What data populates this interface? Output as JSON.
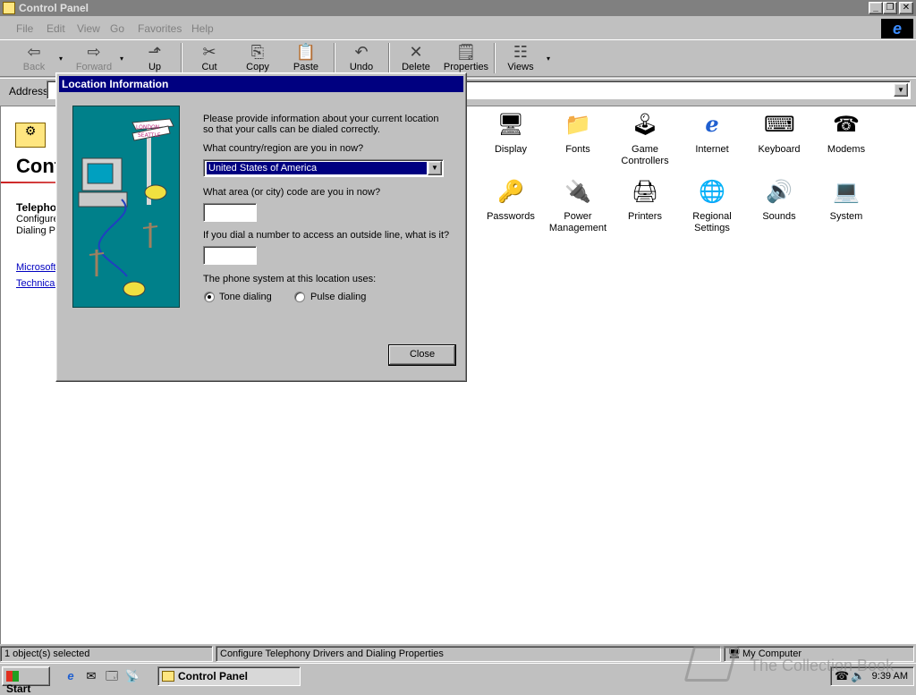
{
  "window": {
    "title": "Control Panel"
  },
  "menu": [
    "File",
    "Edit",
    "View",
    "Go",
    "Favorites",
    "Help"
  ],
  "toolbar": {
    "back": "Back",
    "forward": "Forward",
    "up": "Up",
    "cut": "Cut",
    "copy": "Copy",
    "paste": "Paste",
    "undo": "Undo",
    "delete": "Delete",
    "properties": "Properties",
    "views": "Views"
  },
  "address": {
    "label": "Address"
  },
  "left_pane": {
    "title": "Control Panel",
    "selected_title": "Telephony",
    "selected_desc": "Configure Telephony Drivers and Dialing Properties",
    "link_1": "Microsoft Home",
    "link_2": "Technical Support"
  },
  "icons": [
    {
      "label": "Display",
      "icon": "display-icon",
      "glyph": "🖥"
    },
    {
      "label": "Fonts",
      "icon": "fonts-icon",
      "glyph": "📁"
    },
    {
      "label": "Game Controllers",
      "icon": "game-controllers-icon",
      "glyph": "🕹"
    },
    {
      "label": "Internet",
      "icon": "internet-icon",
      "glyph": "ℯ"
    },
    {
      "label": "Keyboard",
      "icon": "keyboard-icon",
      "glyph": "⌨"
    },
    {
      "label": "Modems",
      "icon": "modems-icon",
      "glyph": "☎"
    },
    {
      "label": "Passwords",
      "icon": "passwords-icon",
      "glyph": "🔑"
    },
    {
      "label": "Power Management",
      "icon": "power-management-icon",
      "glyph": "🔌"
    },
    {
      "label": "Printers",
      "icon": "printers-icon",
      "glyph": "🖨"
    },
    {
      "label": "Regional Settings",
      "icon": "regional-settings-icon",
      "glyph": "🌐"
    },
    {
      "label": "Sounds",
      "icon": "sounds-icon",
      "glyph": "🔊"
    },
    {
      "label": "System",
      "icon": "system-icon",
      "glyph": "💻"
    }
  ],
  "status": {
    "selected": "1 object(s) selected",
    "description": "Configure Telephony Drivers and Dialing Properties",
    "zone": "My Computer"
  },
  "taskbar": {
    "start": "Start",
    "task": "Control Panel",
    "clock": "9:39 AM"
  },
  "dialog": {
    "title": "Location Information",
    "intro": "Please provide information about your current location so that your calls can be dialed correctly.",
    "country_label": "What country/region are you in now?",
    "country_value": "United States of America",
    "area_label": "What area (or city) code are you in now?",
    "outside_label": "If you dial a number to access an outside line, what is it?",
    "phone_label": "The phone system at this location uses:",
    "tone": "Tone dialing",
    "pulse": "Pulse dialing",
    "tone_selected": true,
    "close": "Close",
    "sign_1": "LONDON",
    "sign_2": "SEATTLE"
  },
  "watermark": "The Collection Book",
  "colors": {
    "titlebar_inactive": "#808080",
    "titlebar_active": "#000080",
    "face": "#c0c0c0",
    "dialog_art_bg": "#00808a"
  }
}
